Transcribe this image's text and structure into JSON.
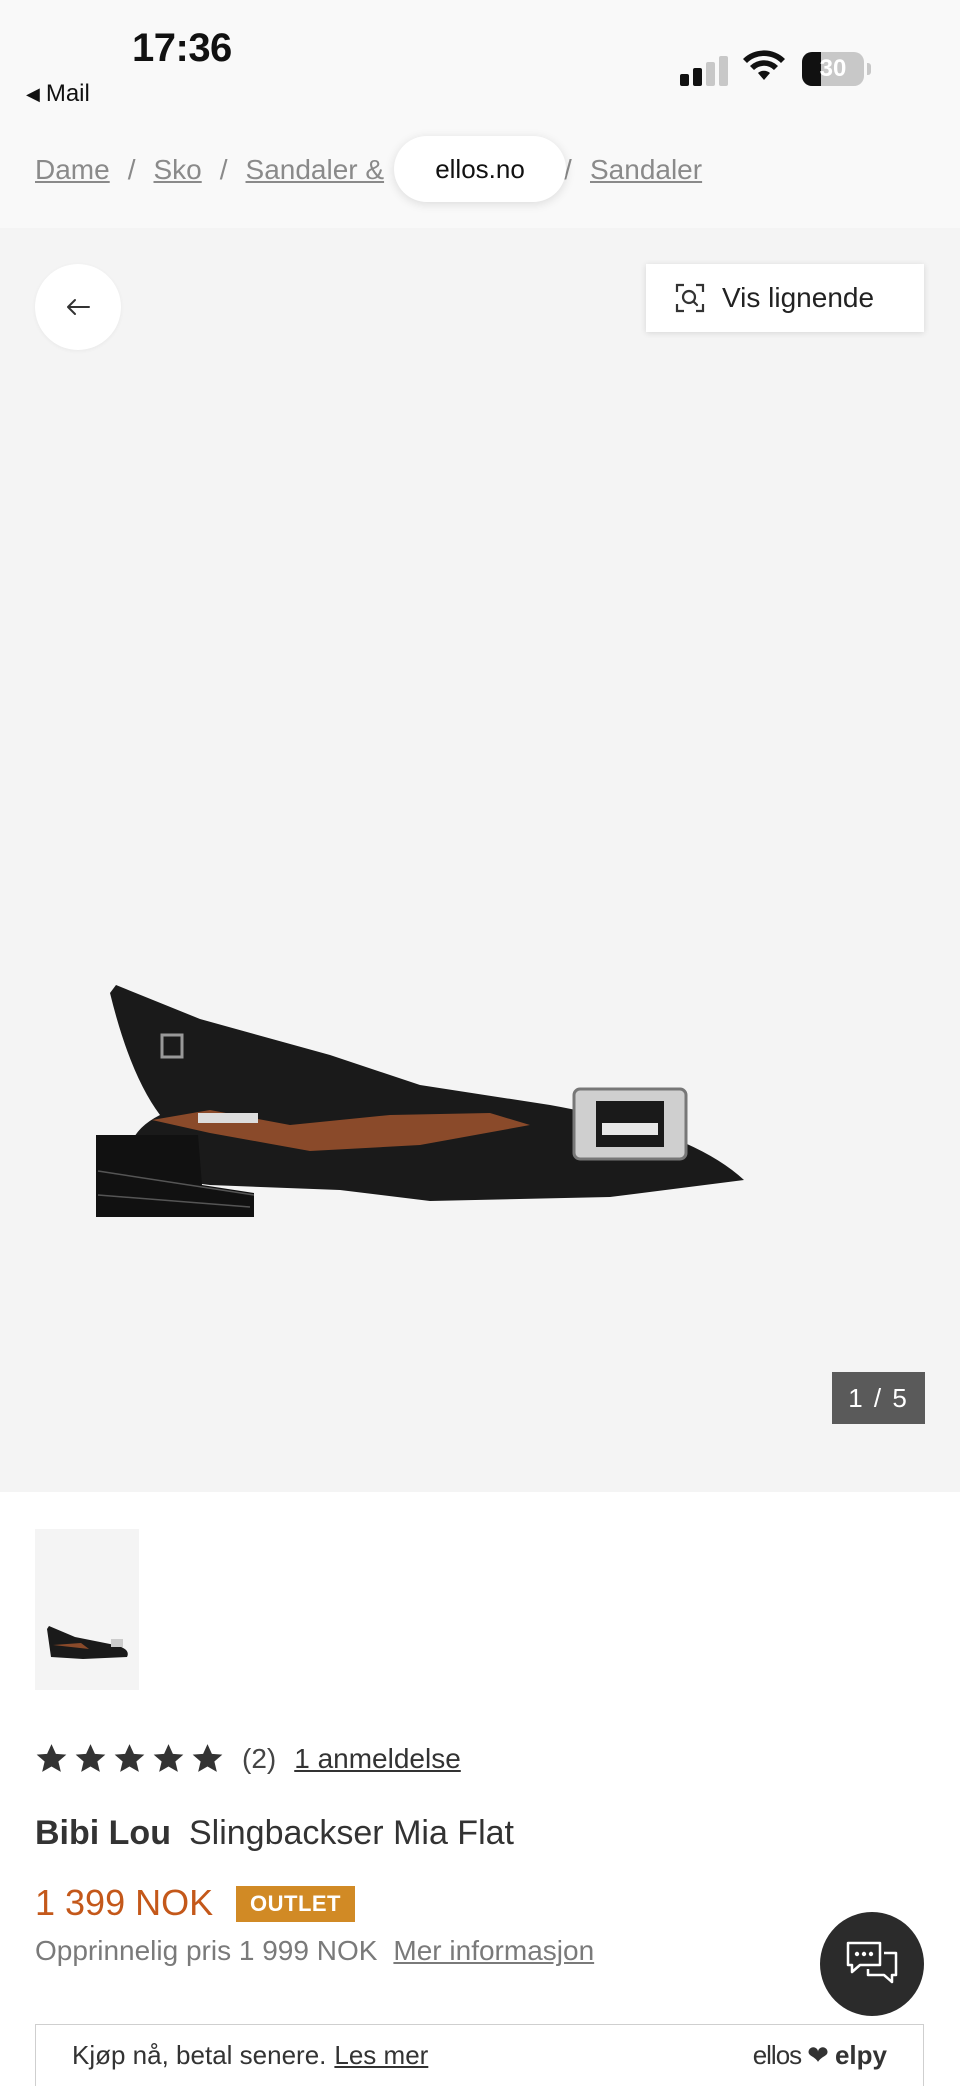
{
  "status_bar": {
    "time": "17:36",
    "back_app": "Mail",
    "battery": "30",
    "battery_level": 0.3
  },
  "browser": {
    "url": "ellos.no"
  },
  "breadcrumbs": [
    "Dame",
    "Sko",
    "Sandaler &",
    "Sandaler"
  ],
  "gallery": {
    "similar_label": "Vis lignende",
    "counter": "1 / 5"
  },
  "product": {
    "rating": 5,
    "rating_count": "(2)",
    "reviews_link": "1 anmeldelse",
    "brand": "Bibi Lou",
    "name": "Slingbackser Mia Flat",
    "price": "1 399 NOK",
    "badge": "OUTLET",
    "original_price": "Opprinnelig pris 1 999 NOK",
    "more_info": "Mer informasjon"
  },
  "payment": {
    "text": "Kjøp nå, betal senere.",
    "link": "Les mer",
    "logo_left": "ellos",
    "logo_heart": "❤",
    "logo_right": "elpy"
  },
  "colors": {
    "price": "#c4581a",
    "badge": "#d18a25",
    "gallery_bg": "#f4f4f4",
    "counter_bg": "#5a5a5a",
    "chat_bg": "#2b2b2b"
  }
}
